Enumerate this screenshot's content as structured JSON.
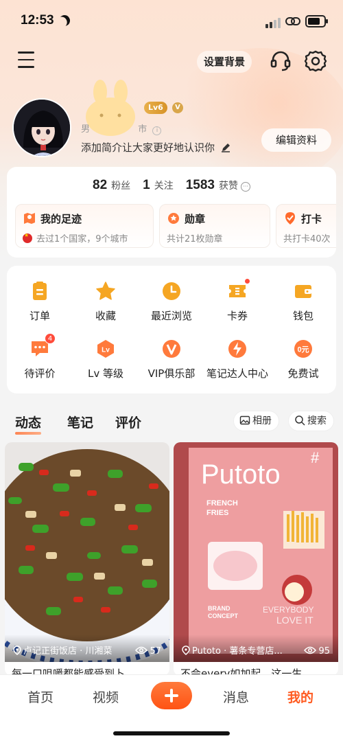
{
  "status_bar": {
    "time": "12:53",
    "battery_level": 0.75
  },
  "header": {
    "set_background": "设置背景"
  },
  "profile": {
    "level": "Lv6",
    "verified": "V",
    "location_partial": "男",
    "location_suffix": "市",
    "bio": "添加简介让大家更好地认识你",
    "edit_label": "编辑资料"
  },
  "stats": {
    "fans_count": "82",
    "fans_label": "粉丝",
    "following_count": "1",
    "following_label": "关注",
    "likes_count": "1583",
    "likes_label": "获赞"
  },
  "tiles": [
    {
      "title": "我的足迹",
      "subtitle": "去过1个国家，9个城市"
    },
    {
      "title": "勋章",
      "subtitle": "共计21枚勋章"
    },
    {
      "title": "打卡",
      "subtitle": "共打卡40次"
    }
  ],
  "services": [
    {
      "label": "订单",
      "icon": "clipboard-icon"
    },
    {
      "label": "收藏",
      "icon": "star-icon"
    },
    {
      "label": "最近浏览",
      "icon": "clock-icon"
    },
    {
      "label": "卡券",
      "icon": "ticket-icon"
    },
    {
      "label": "钱包",
      "icon": "wallet-icon"
    },
    {
      "label": "待评价",
      "icon": "comment-icon",
      "badge": "4"
    },
    {
      "label": "Lv 等级",
      "icon": "level-icon"
    },
    {
      "label": "VIP俱乐部",
      "icon": "vip-icon"
    },
    {
      "label": "笔记达人中心",
      "icon": "bolt-icon"
    },
    {
      "label": "免费试",
      "icon": "coin-icon"
    }
  ],
  "tabs": {
    "dynamic": "动态",
    "notes": "笔记",
    "reviews": "评价",
    "album": "相册",
    "search": "搜索"
  },
  "feed": [
    {
      "location": "卢记正街饭店 · 川湘菜",
      "views": "57",
      "title": "每一口咀嚼都能感受到卜"
    },
    {
      "location": "Putoto · 薯条专营店...",
      "views": "95",
      "title": "不会every如加起，这一生..."
    }
  ],
  "bottom_nav": {
    "home": "首页",
    "video": "视频",
    "messages": "消息",
    "mine": "我的"
  },
  "colors": {
    "accent": "#ff5a20",
    "gold": "#f5a623"
  }
}
